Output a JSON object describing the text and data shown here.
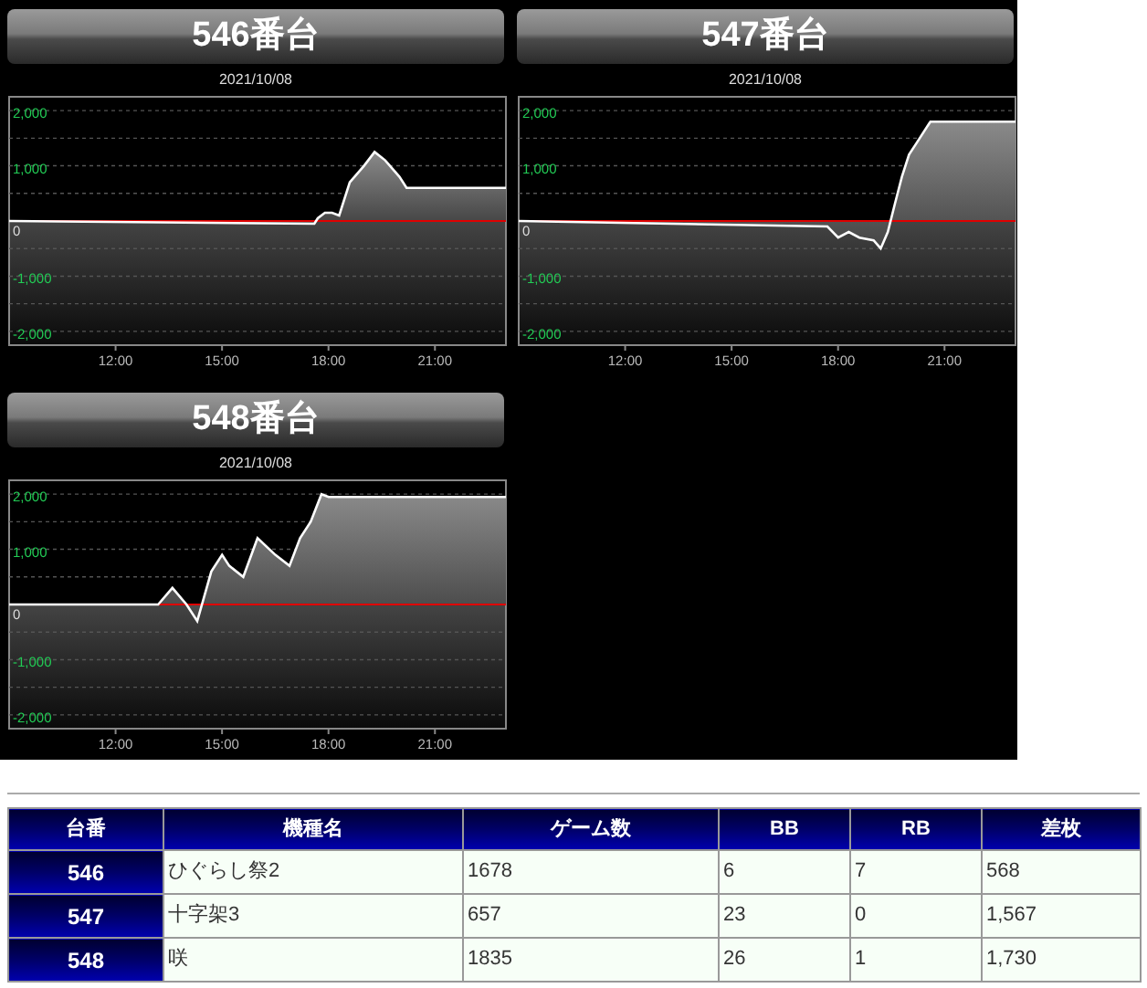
{
  "panels": [
    {
      "title": "546番台",
      "date": "2021/10/08",
      "chart_data": {
        "type": "area",
        "grid": true,
        "ref_lines": [
          {
            "axis": "y",
            "value": 0,
            "color": "#e00000"
          }
        ],
        "xlim": [
          9,
          23
        ],
        "ylim": [
          -2250,
          2250
        ],
        "xticks": [
          {
            "value": 12,
            "label": "12:00"
          },
          {
            "value": 15,
            "label": "15:00"
          },
          {
            "value": 18,
            "label": "18:00"
          },
          {
            "value": 21,
            "label": "21:00"
          }
        ],
        "yticks": [
          {
            "value": 2000,
            "label": "2,000"
          },
          {
            "value": 1000,
            "label": "1,000"
          },
          {
            "value": 0,
            "label": "0"
          },
          {
            "value": -1000,
            "label": "-1,000"
          },
          {
            "value": -2000,
            "label": "-2,000"
          }
        ],
        "x": [
          9,
          17.6,
          17.7,
          17.9,
          18.1,
          18.3,
          18.6,
          19,
          19.3,
          19.6,
          20,
          20.2,
          23
        ],
        "series": [
          {
            "color": "#ffffff",
            "values": [
              0,
              -50,
              50,
              150,
              150,
              100,
              700,
              1000,
              1250,
              1100,
              800,
              600,
              600
            ]
          }
        ]
      }
    },
    {
      "title": "547番台",
      "date": "2021/10/08",
      "chart_data": {
        "type": "area",
        "grid": true,
        "ref_lines": [
          {
            "axis": "y",
            "value": 0,
            "color": "#e00000"
          }
        ],
        "xlim": [
          9,
          23
        ],
        "ylim": [
          -2250,
          2250
        ],
        "xticks": [
          {
            "value": 12,
            "label": "12:00"
          },
          {
            "value": 15,
            "label": "15:00"
          },
          {
            "value": 18,
            "label": "18:00"
          },
          {
            "value": 21,
            "label": "21:00"
          }
        ],
        "yticks": [
          {
            "value": 2000,
            "label": "2,000"
          },
          {
            "value": 1000,
            "label": "1,000"
          },
          {
            "value": 0,
            "label": "0"
          },
          {
            "value": -1000,
            "label": "-1,000"
          },
          {
            "value": -2000,
            "label": "-2,000"
          }
        ],
        "x": [
          9,
          17.7,
          18,
          18.3,
          18.6,
          19,
          19.2,
          19.4,
          19.6,
          19.8,
          20,
          20.2,
          20.6,
          23
        ],
        "series": [
          {
            "color": "#ffffff",
            "values": [
              0,
              -100,
              -300,
              -200,
              -300,
              -350,
              -500,
              -200,
              300,
              800,
              1200,
              1400,
              1800,
              1800
            ]
          }
        ]
      }
    },
    {
      "title": "548番台",
      "date": "2021/10/08",
      "chart_data": {
        "type": "area",
        "grid": true,
        "ref_lines": [
          {
            "axis": "y",
            "value": 0,
            "color": "#e00000"
          }
        ],
        "xlim": [
          9,
          23
        ],
        "ylim": [
          -2250,
          2250
        ],
        "xticks": [
          {
            "value": 12,
            "label": "12:00"
          },
          {
            "value": 15,
            "label": "15:00"
          },
          {
            "value": 18,
            "label": "18:00"
          },
          {
            "value": 21,
            "label": "21:00"
          }
        ],
        "yticks": [
          {
            "value": 2000,
            "label": "2,000"
          },
          {
            "value": 1000,
            "label": "1,000"
          },
          {
            "value": 0,
            "label": "0"
          },
          {
            "value": -1000,
            "label": "-1,000"
          },
          {
            "value": -2000,
            "label": "-2,000"
          }
        ],
        "x": [
          9,
          13.2,
          13.6,
          14,
          14.3,
          14.7,
          15,
          15.2,
          15.6,
          16,
          16.5,
          16.9,
          17.2,
          17.5,
          17.8,
          18,
          23
        ],
        "series": [
          {
            "color": "#ffffff",
            "values": [
              0,
              0,
              300,
              0,
              -300,
              600,
              900,
              700,
              500,
              1200,
              900,
              700,
              1200,
              1500,
              2000,
              1950,
              1950
            ]
          }
        ]
      }
    }
  ],
  "table": {
    "columns": [
      "台番",
      "機種名",
      "ゲーム数",
      "BB",
      "RB",
      "差枚"
    ],
    "rows": [
      [
        "546",
        "ひぐらし祭2",
        "1678",
        "6",
        "7",
        "568"
      ],
      [
        "547",
        "十字架3",
        "657",
        "23",
        "0",
        "1,567"
      ],
      [
        "548",
        "咲",
        "1835",
        "26",
        "1",
        "1,730"
      ]
    ]
  }
}
